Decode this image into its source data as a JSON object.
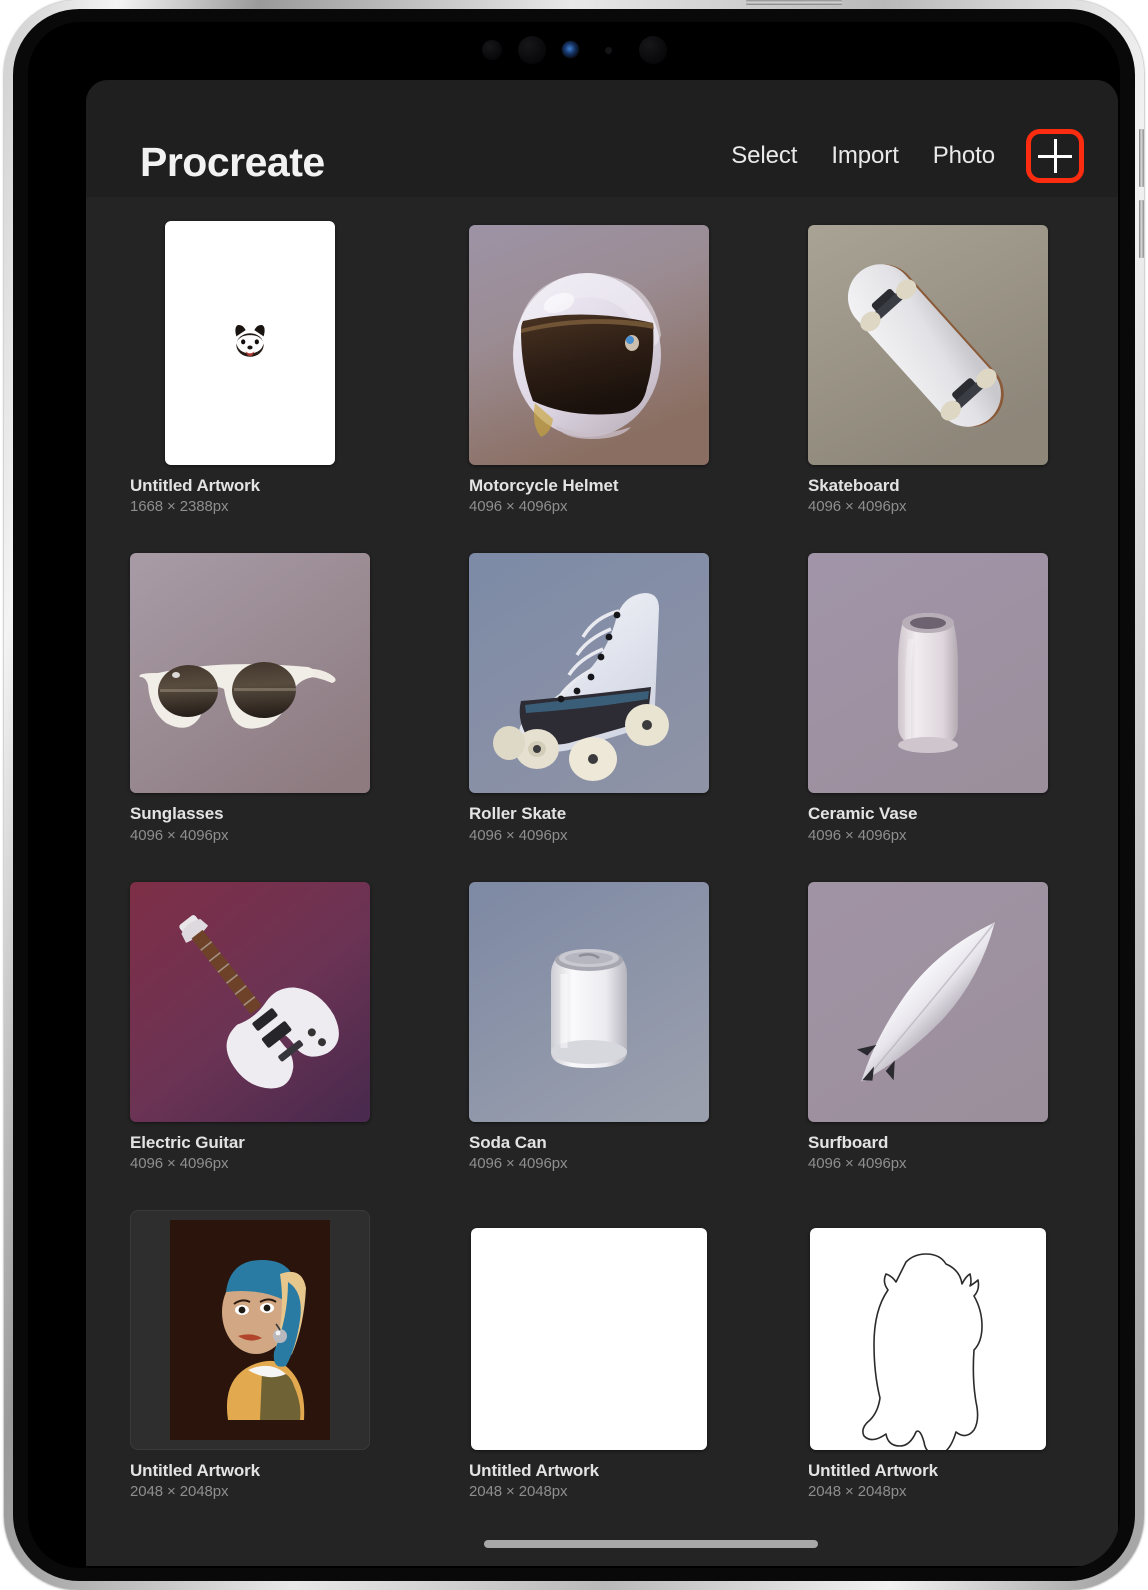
{
  "app": {
    "title": "Procreate",
    "header_buttons": [
      {
        "label": "Select",
        "name": "select-button"
      },
      {
        "label": "Import",
        "name": "import-button"
      },
      {
        "label": "Photo",
        "name": "photo-button"
      }
    ],
    "add_button": {
      "icon": "plus-icon",
      "highlight_color": "#fc2c10"
    }
  },
  "gallery": {
    "artworks": [
      {
        "title": "Untitled Artwork",
        "size": "1668 × 2388px",
        "thumb": "dog-face-sketch"
      },
      {
        "title": "Motorcycle Helmet",
        "size": "4096 × 4096px",
        "thumb": "motorcycle-helmet-render"
      },
      {
        "title": "Skateboard",
        "size": "4096 × 4096px",
        "thumb": "skateboard-render"
      },
      {
        "title": "Sunglasses",
        "size": "4096 × 4096px",
        "thumb": "sunglasses-render"
      },
      {
        "title": "Roller Skate",
        "size": "4096 × 4096px",
        "thumb": "roller-skate-render"
      },
      {
        "title": "Ceramic Vase",
        "size": "4096 × 4096px",
        "thumb": "ceramic-vase-render"
      },
      {
        "title": "Electric Guitar",
        "size": "4096 × 4096px",
        "thumb": "electric-guitar-render"
      },
      {
        "title": "Soda Can",
        "size": "4096 × 4096px",
        "thumb": "soda-can-render"
      },
      {
        "title": "Surfboard",
        "size": "4096 × 4096px",
        "thumb": "surfboard-render"
      },
      {
        "title": "Untitled Artwork",
        "size": "2048 × 2048px",
        "thumb": "girl-with-pearl-earring-illustration"
      },
      {
        "title": "Untitled Artwork",
        "size": "2048 × 2048px",
        "thumb": "blank-white-canvas"
      },
      {
        "title": "Untitled Artwork",
        "size": "2048 × 2048px",
        "thumb": "bear-outline-sketch"
      }
    ]
  },
  "colors": {
    "header_bg": "#1f1f1f",
    "gallery_bg": "#242424",
    "title_text": "#f2f2f2",
    "meta_text": "#8e8e8e",
    "highlight": "#fc2c10"
  }
}
